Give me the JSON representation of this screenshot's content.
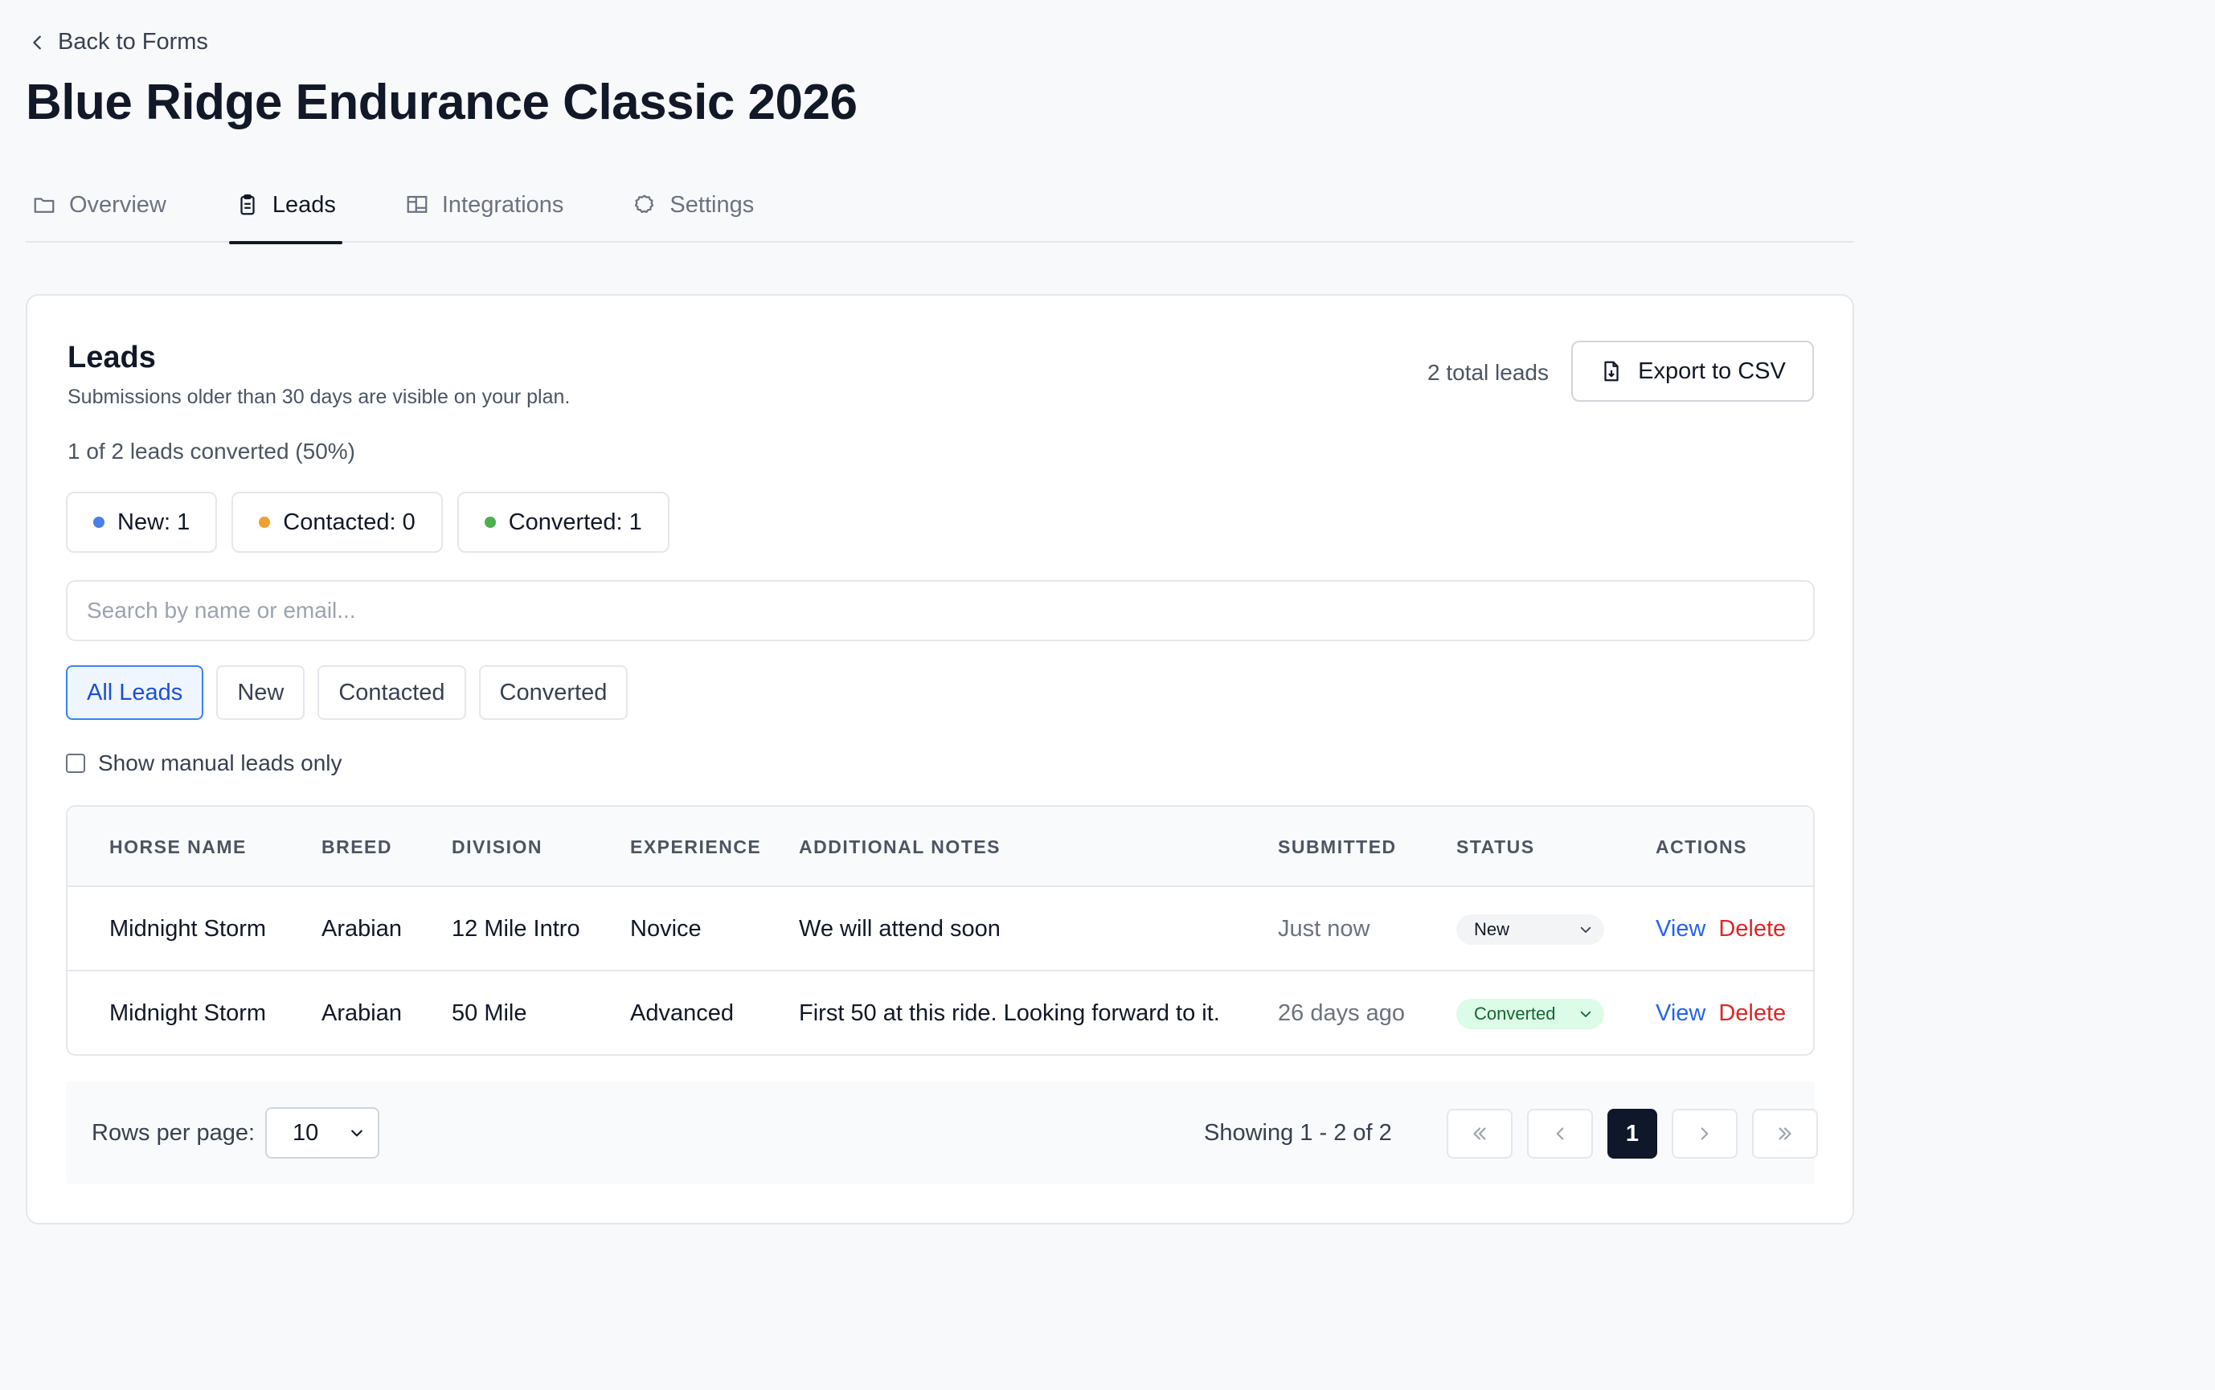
{
  "nav": {
    "back_label": "Back to Forms"
  },
  "page": {
    "title": "Blue Ridge Endurance Classic 2026"
  },
  "tabs": [
    {
      "label": "Overview",
      "icon": "folder-icon"
    },
    {
      "label": "Leads",
      "icon": "clipboard-icon",
      "active": true
    },
    {
      "label": "Integrations",
      "icon": "layout-icon"
    },
    {
      "label": "Settings",
      "icon": "gear-icon"
    }
  ],
  "leads": {
    "title": "Leads",
    "subtitle": "Submissions older than 30 days are visible on your plan.",
    "total_label": "2 total leads",
    "export_label": "Export to CSV",
    "conversion_summary": "1 of 2 leads converted (50%)",
    "stats": [
      {
        "label": "New: 1",
        "color": "#4a7fe8"
      },
      {
        "label": "Contacted: 0",
        "color": "#f0a030"
      },
      {
        "label": "Converted: 1",
        "color": "#4caf50"
      }
    ],
    "search_placeholder": "Search by name or email...",
    "filters": [
      "All Leads",
      "New",
      "Contacted",
      "Converted"
    ],
    "active_filter": "All Leads",
    "manual_only_label": "Show manual leads only",
    "table": {
      "columns": [
        "HORSE NAME",
        "BREED",
        "DIVISION",
        "EXPERIENCE",
        "ADDITIONAL NOTES",
        "SUBMITTED",
        "STATUS",
        "ACTIONS"
      ],
      "rows": [
        {
          "horse": "Midnight Storm",
          "breed": "Arabian",
          "division": "12 Mile Intro",
          "experience": "Novice",
          "notes": "We will attend soon",
          "submitted": "Just now",
          "status": "New",
          "view": "View",
          "delete": "Delete"
        },
        {
          "horse": "Midnight Storm",
          "breed": "Arabian",
          "division": "50 Mile",
          "experience": "Advanced",
          "notes": "First 50 at this ride. Looking forward to it.",
          "submitted": "26 days ago",
          "status": "Converted",
          "view": "View",
          "delete": "Delete"
        }
      ]
    },
    "pagination": {
      "rows_per_page_label": "Rows per page:",
      "rows_per_page_value": "10",
      "showing": "Showing 1 - 2 of 2",
      "current_page": "1"
    }
  }
}
